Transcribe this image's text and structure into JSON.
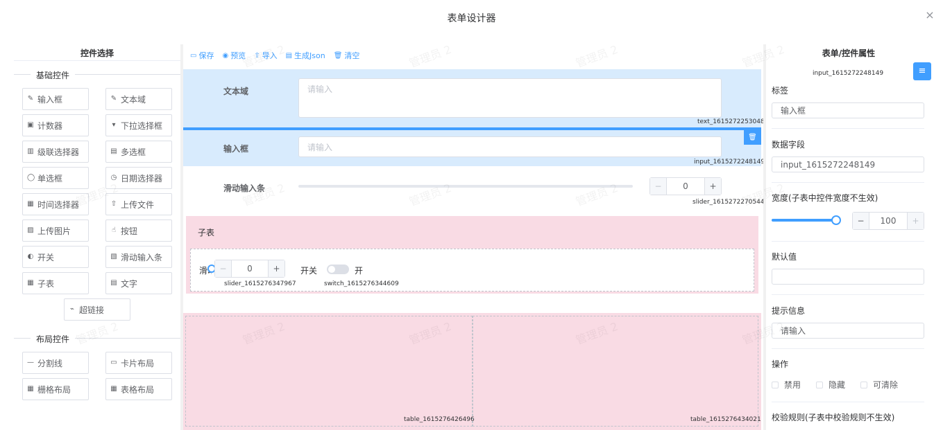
{
  "dialog": {
    "title": "表单设计器",
    "close_icon": "×"
  },
  "left": {
    "title": "控件选择",
    "basic_header": "基础控件",
    "layout_header": "布局控件",
    "basic": [
      "输入框",
      "文本域",
      "计数器",
      "下拉选择框",
      "级联选择器",
      "多选框",
      "单选框",
      "日期选择器",
      "时间选择器",
      "上传文件",
      "上传图片",
      "按钮",
      "开关",
      "滑动输入条",
      "子表",
      "文字",
      "超链接"
    ],
    "layout": [
      "分割线",
      "卡片布局",
      "栅格布局",
      "表格布局"
    ]
  },
  "toolbar": [
    "保存",
    "预览",
    "导入",
    "生成Json",
    "清空"
  ],
  "canvas": {
    "textarea": {
      "label": "文本域",
      "placeholder": "请输入",
      "id": "text_1615272253048"
    },
    "input": {
      "label": "输入框",
      "placeholder": "请输入",
      "id": "input_1615272248149"
    },
    "slider": {
      "label": "滑动输入条",
      "value": "0",
      "id": "slider_1615272270544",
      "minus": "−",
      "plus": "+",
      "level": 0
    },
    "subtable": {
      "label": "子表",
      "slider_label": "滑动",
      "slider_value": "0",
      "slider_id": "slider_1615276347967",
      "switch_label": "开关",
      "switch_on": "开",
      "switch_id": "switch_1615276344609"
    },
    "table_ids": [
      "table_1615276426496",
      "table_1615276434021"
    ]
  },
  "right": {
    "title": "表单/控件属性",
    "field_id": "input_1615272248149",
    "label_title": "标签",
    "label_value": "输入框",
    "data_field_title": "数据字段",
    "data_field_value": "input_1615272248149",
    "width_title": "宽度(子表中控件宽度不生效)",
    "width_value": "100",
    "width_level": 1.0,
    "default_title": "默认值",
    "default_value": "",
    "hint_title": "提示信息",
    "hint_value": "请输入",
    "ops_title": "操作",
    "ops": [
      "禁用",
      "隐藏",
      "可清除"
    ],
    "rules_title": "校验规则(子表中校验规则不生效)"
  },
  "watermark": "管理员 2",
  "colors": {
    "primary": "#409eff",
    "selected_bg": "#d8ebfd",
    "pink_bg": "#f9dbe4"
  }
}
